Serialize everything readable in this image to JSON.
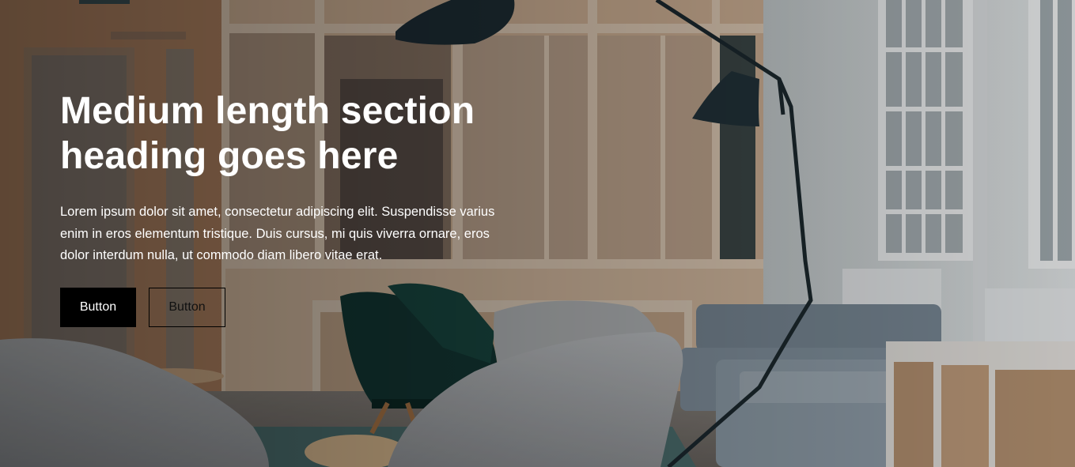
{
  "hero": {
    "heading": "Medium length section heading goes here",
    "body": "Lorem ipsum dolor sit amet, consectetur adipiscing elit. Suspendisse varius enim in eros elementum tristique. Duis cursus, mi quis viverra ornare, eros dolor interdum nulla, ut commodo diam libero vitae erat.",
    "primary_button": "Button",
    "secondary_button": "Button"
  },
  "colors": {
    "primary_button_bg": "#000000",
    "text_on_image": "#ffffff"
  }
}
